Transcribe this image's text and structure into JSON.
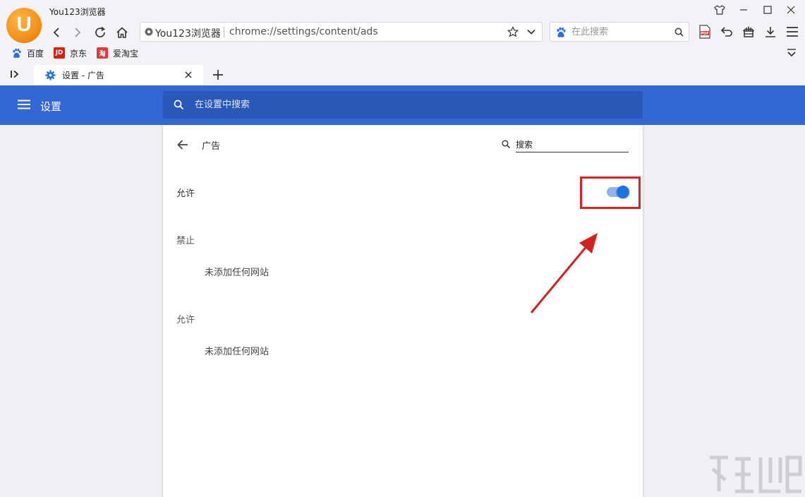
{
  "window": {
    "app_title": "You123浏览器"
  },
  "address_bar": {
    "site_name": "You123浏览器",
    "url": "chrome://settings/content/ads"
  },
  "search_box": {
    "placeholder": "在此搜索"
  },
  "bookmarks": [
    {
      "label": "百度",
      "icon": "baidu-paw-icon",
      "icon_text": "",
      "color": "#2b6de5"
    },
    {
      "label": "京东",
      "icon": "jd-icon",
      "icon_text": "JD",
      "color": "#d81e06"
    },
    {
      "label": "爱淘宝",
      "icon": "taobao-icon",
      "icon_text": "淘",
      "color": "#e4393c"
    }
  ],
  "tab": {
    "title": "设置 - 广告"
  },
  "settings": {
    "title": "设置",
    "search_placeholder": "在设置中搜索",
    "page_title": "广告",
    "page_search_placeholder": "搜索",
    "allow_label": "允许",
    "allow_enabled": true,
    "blocked": {
      "header": "禁止",
      "empty": "未添加任何网站"
    },
    "allowed": {
      "header": "允许",
      "empty": "未添加任何网站"
    }
  },
  "colors": {
    "accent": "#3367d6",
    "toggle_on": "#1a73e8",
    "annotation": "#e32020",
    "logo": "#f7941d"
  }
}
